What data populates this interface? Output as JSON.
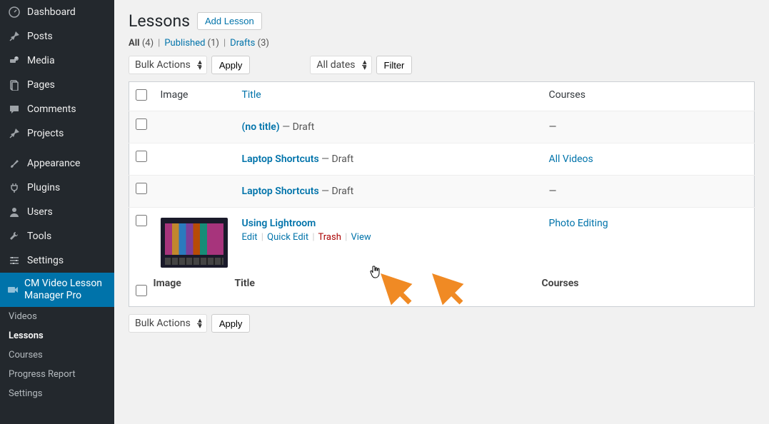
{
  "sidebar": {
    "items": [
      {
        "icon": "dashboard",
        "label": "Dashboard"
      },
      {
        "icon": "pin",
        "label": "Posts"
      },
      {
        "icon": "media",
        "label": "Media"
      },
      {
        "icon": "page",
        "label": "Pages"
      },
      {
        "icon": "comments",
        "label": "Comments"
      },
      {
        "icon": "pin",
        "label": "Projects"
      }
    ],
    "items2": [
      {
        "icon": "brush",
        "label": "Appearance"
      },
      {
        "icon": "plug",
        "label": "Plugins"
      },
      {
        "icon": "user",
        "label": "Users"
      },
      {
        "icon": "wrench",
        "label": "Tools"
      },
      {
        "icon": "sliders",
        "label": "Settings"
      }
    ],
    "active": {
      "icon": "camera",
      "label": "CM Video Lesson Manager Pro"
    },
    "subitems": [
      {
        "label": "Videos"
      },
      {
        "label": "Lessons",
        "current": true
      },
      {
        "label": "Courses"
      },
      {
        "label": "Progress Report"
      },
      {
        "label": "Settings"
      }
    ]
  },
  "page": {
    "title": "Lessons",
    "add_button": "Add Lesson"
  },
  "status_links": {
    "all_label": "All",
    "all_count": "(4)",
    "published_label": "Published",
    "published_count": "(1)",
    "drafts_label": "Drafts",
    "drafts_count": "(3)"
  },
  "toolbar": {
    "bulk_label": "Bulk Actions",
    "apply": "Apply",
    "dates_label": "All dates",
    "filter": "Filter"
  },
  "columns": {
    "image": "Image",
    "title": "Title",
    "courses": "Courses"
  },
  "rows": [
    {
      "title": "(no title)",
      "status": " — Draft",
      "courses": "—",
      "has_thumb": false
    },
    {
      "title": "Laptop Shortcuts",
      "status": " — Draft",
      "courses": "All Videos",
      "courses_link": true,
      "has_thumb": false
    },
    {
      "title": "Laptop Shortcuts",
      "status": " — Draft",
      "courses": "—",
      "has_thumb": false
    },
    {
      "title": "Using Lightroom",
      "status": "",
      "courses": "Photo Editing",
      "courses_link": true,
      "has_thumb": true,
      "actions": {
        "edit": "Edit",
        "quick": "Quick Edit",
        "trash": "Trash",
        "view": "View"
      }
    }
  ],
  "bottom_toolbar": {
    "bulk_label": "Bulk Actions",
    "apply": "Apply"
  }
}
